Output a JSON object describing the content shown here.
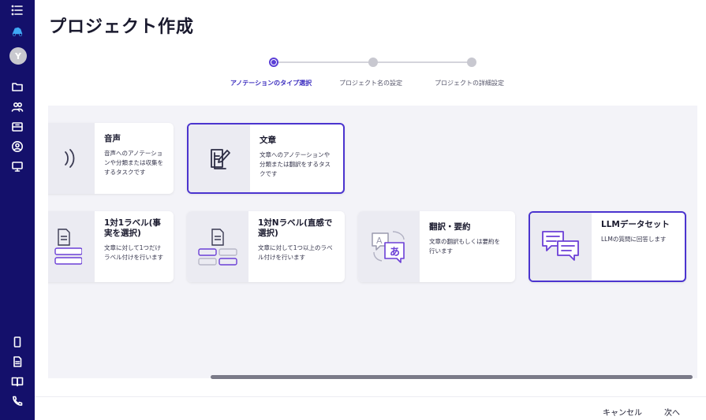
{
  "sidebar": {
    "avatar_initial": "Y",
    "top_icons": [
      "menu-icon",
      "app-logo-icon"
    ],
    "nav_icons": [
      "folder-icon",
      "users-icon",
      "inbox-icon",
      "account-circle-icon",
      "monitor-icon"
    ],
    "bottom_icons": [
      "mobile-icon",
      "document-icon",
      "book-icon",
      "phone-icon"
    ],
    "background_color": "#14106b"
  },
  "header": {
    "title": "プロジェクト作成"
  },
  "stepper": {
    "steps": [
      {
        "label": "アノテーションのタイプ選択",
        "active": true
      },
      {
        "label": "プロジェクト名の設定",
        "active": false
      },
      {
        "label": "プロジェクトの詳細設定",
        "active": false
      }
    ],
    "accent_color": "#5b3fd6"
  },
  "cards": [
    {
      "id": "audio",
      "title": "音声",
      "desc": "音声へのアノテーションや分類または収集をするタスクです",
      "selected": false,
      "icon": "audio-wave-icon"
    },
    {
      "id": "text",
      "title": "文章",
      "desc": "文章へのアノテーションや分類または翻訳をするタスクです",
      "selected": true,
      "icon": "edit-document-icon"
    },
    {
      "id": "single-label",
      "title": "1対1ラベル(事実を選択)",
      "desc": "文章に対して1つだけラベル付けを行います",
      "selected": false,
      "icon": "single-label-icon",
      "chips": [
        "•••▾",
        "▲▲▾"
      ]
    },
    {
      "id": "multi-label",
      "title": "1対Nラベル(直感で選択)",
      "desc": "文章に対して1つ以上のラベル付けを行います",
      "selected": false,
      "icon": "multi-label-icon",
      "chips": [
        "1.•••",
        "2.▲▲",
        "3.▲▲",
        "4.•••"
      ]
    },
    {
      "id": "translation",
      "title": "翻訳・要約",
      "desc": "文章の翻訳もしくは要約を行います",
      "selected": false,
      "icon": "translate-icon",
      "glyphs": [
        "A",
        "あ"
      ]
    },
    {
      "id": "llm",
      "title": "LLMデータセット",
      "desc": "LLMの質問に回答します",
      "selected": true,
      "icon": "chat-bubbles-icon"
    }
  ],
  "footer": {
    "cancel_label": "キャンセル",
    "next_label": "次へ"
  }
}
